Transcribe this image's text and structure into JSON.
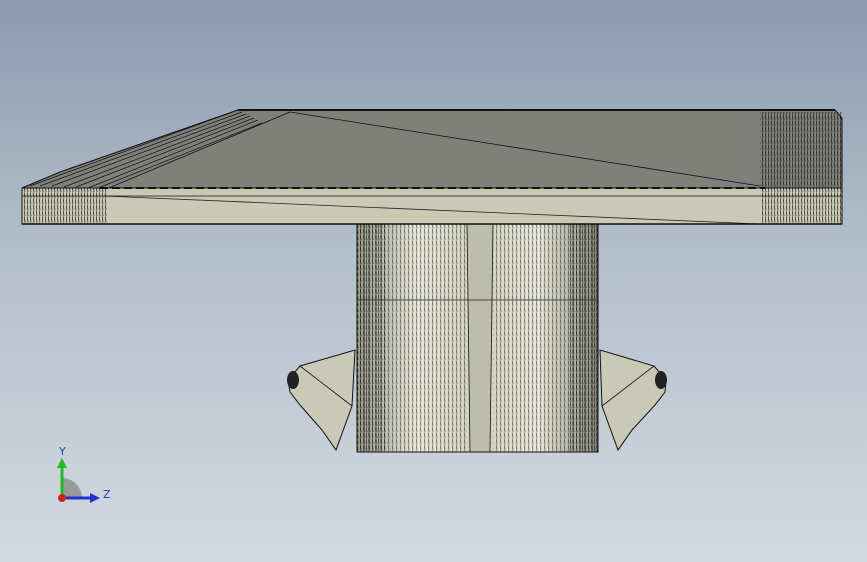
{
  "viewport": {
    "background_top": "#8a9ab0",
    "background_bottom": "#d3d9df"
  },
  "model": {
    "face_light": "#c9c9b6",
    "face_mid": "#b6b6a3",
    "face_dark": "#7f807a",
    "edge_color": "#111111"
  },
  "triad": {
    "y_label": "Y",
    "z_label": "Z",
    "y_color": "#22bb22",
    "z_color": "#2233cc",
    "x_color": "#cc2222"
  }
}
